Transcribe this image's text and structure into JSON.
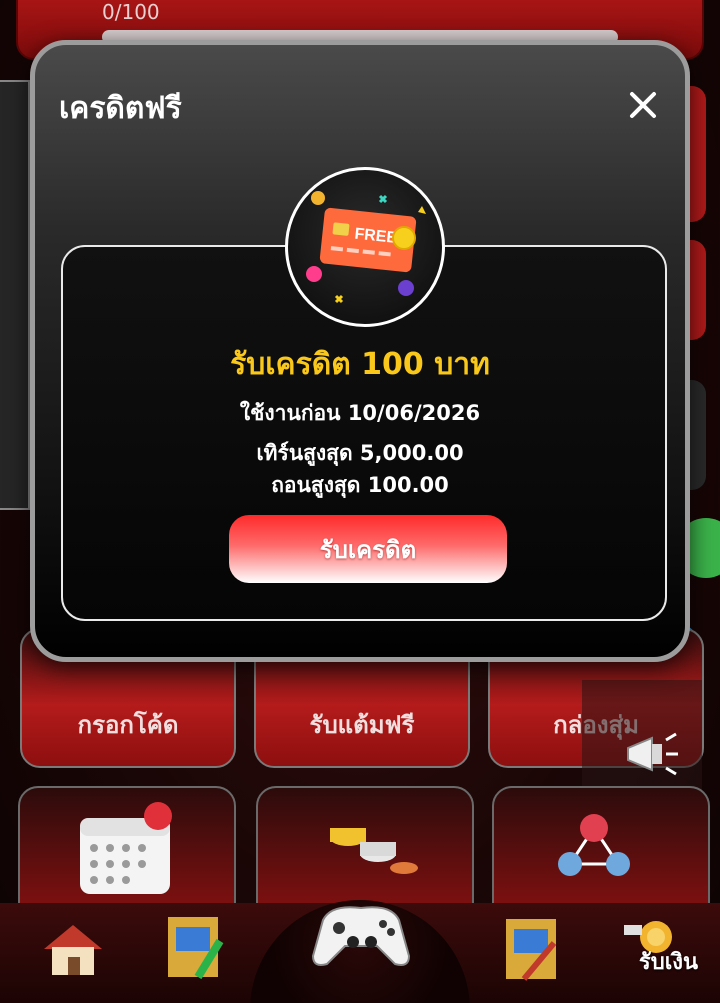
{
  "background": {
    "progress_text": "0/100",
    "progress_fraction": 0,
    "menu_tiles": [
      {
        "label": "กรอกโค้ด"
      },
      {
        "label": "รับแต้มฟรี"
      },
      {
        "label": "กล่องสุ่ม"
      }
    ],
    "bottom_nav": {
      "visible_label": "รับเงิน"
    }
  },
  "modal": {
    "title": "เครดิตฟรี",
    "close_icon": "close-icon",
    "badge_icon": "free-credit-card-icon",
    "badge_card_text": "FREE",
    "credit_amount": "รับเครดิต 100 บาท",
    "use_before": "ใช้งานก่อน 10/06/2026",
    "max_turnover": "เทิร์นสูงสุด 5,000.00",
    "max_withdraw": "ถอนสูงสุด 100.00",
    "claim_button": "รับเครดิต"
  },
  "colors": {
    "accent_yellow": "#f9c81a",
    "brand_red": "#b51818",
    "button_red": "#ff2b2b"
  }
}
